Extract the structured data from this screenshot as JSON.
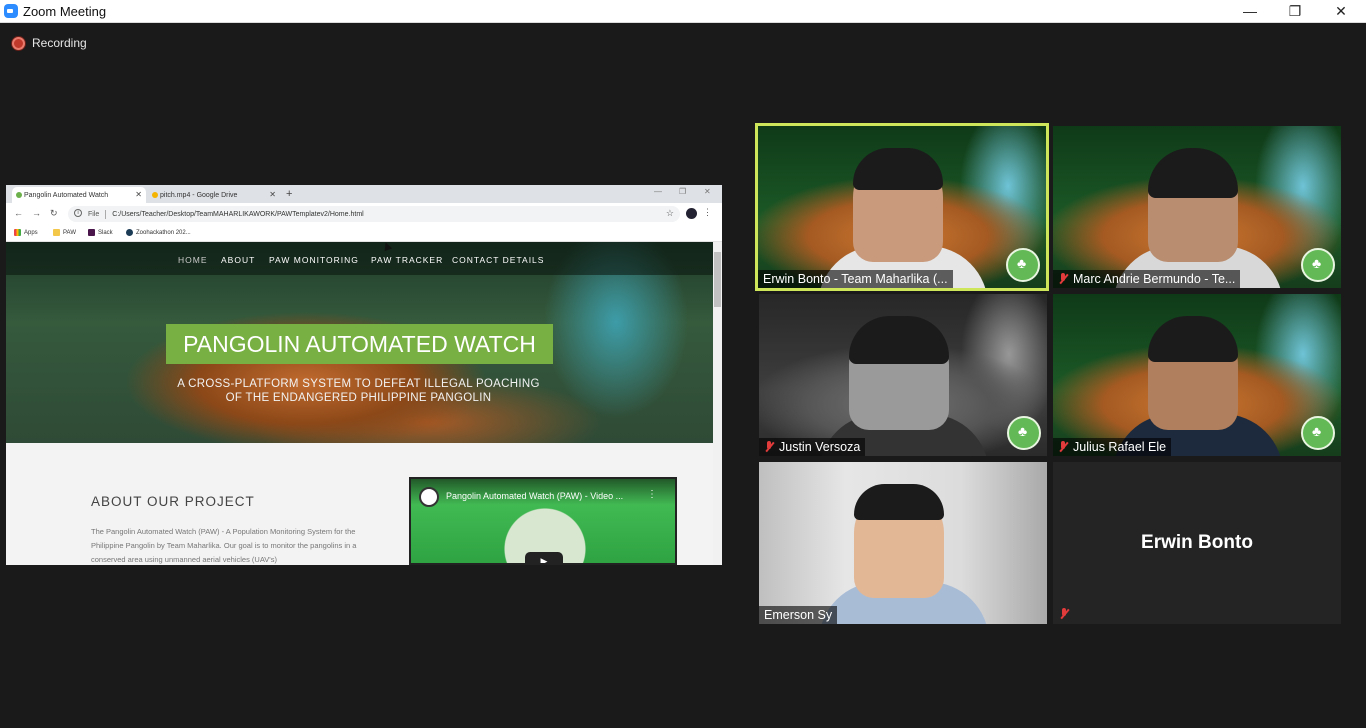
{
  "window": {
    "title": "Zoom Meeting",
    "minimize": "—",
    "restore": "❐",
    "close": "✕"
  },
  "recording": {
    "label": "Recording"
  },
  "browser": {
    "tabs": [
      {
        "label": "Pangolin Automated Watch",
        "close": "✕"
      },
      {
        "label": "pitch.mp4 - Google Drive",
        "close": "✕"
      }
    ],
    "new_tab": "+",
    "address": {
      "scheme": "File",
      "url": "C:/Users/Teacher/Desktop/TeamMAHARLIKAWORK/PAWTemplatev2/Home.html"
    },
    "bookmarks": [
      "Apps",
      "PAW",
      "Slack",
      "Zoohackathon 202..."
    ],
    "icons": {
      "back": "←",
      "forward": "→",
      "reload": "↻",
      "star": "☆",
      "menu": "⋮"
    }
  },
  "site": {
    "nav": [
      "HOME",
      "ABOUT",
      "PAW MONITORING",
      "PAW TRACKER",
      "CONTACT DETAILS"
    ],
    "hero_title": "PANGOLIN AUTOMATED WATCH",
    "hero_subtitle_1": "A CROSS-PLATFORM SYSTEM TO DEFEAT ILLEGAL POACHING",
    "hero_subtitle_2": "OF THE ENDANGERED PHILIPPINE PANGOLIN",
    "about_heading": "ABOUT OUR PROJECT",
    "about_text": "The Pangolin Automated Watch (PAW) - A Population Monitoring System for the Philippine Pangolin by Team Maharlika. Our goal is to monitor the pangolins in a conserved area using unmanned aerial vehicles (UAV's)",
    "video_title": "Pangolin Automated Watch (PAW) - Video ...",
    "video_menu": "⋮",
    "video_play": "▶"
  },
  "participants": [
    {
      "name": "Erwin Bonto - Team Maharlika (...",
      "muted": false
    },
    {
      "name": "Marc Andrie Bermundo - Te...",
      "muted": true
    },
    {
      "name": "Justin Versoza",
      "muted": true
    },
    {
      "name": "Julius Rafael Ele",
      "muted": true
    },
    {
      "name": "Emerson Sy",
      "muted": false
    },
    {
      "name": "Erwin Bonto",
      "muted": true,
      "camera_off": true
    }
  ],
  "colors": {
    "active_speaker": "#cde65a",
    "hero_title_bg": "#79b043",
    "muted_icon": "#e23b3b"
  }
}
